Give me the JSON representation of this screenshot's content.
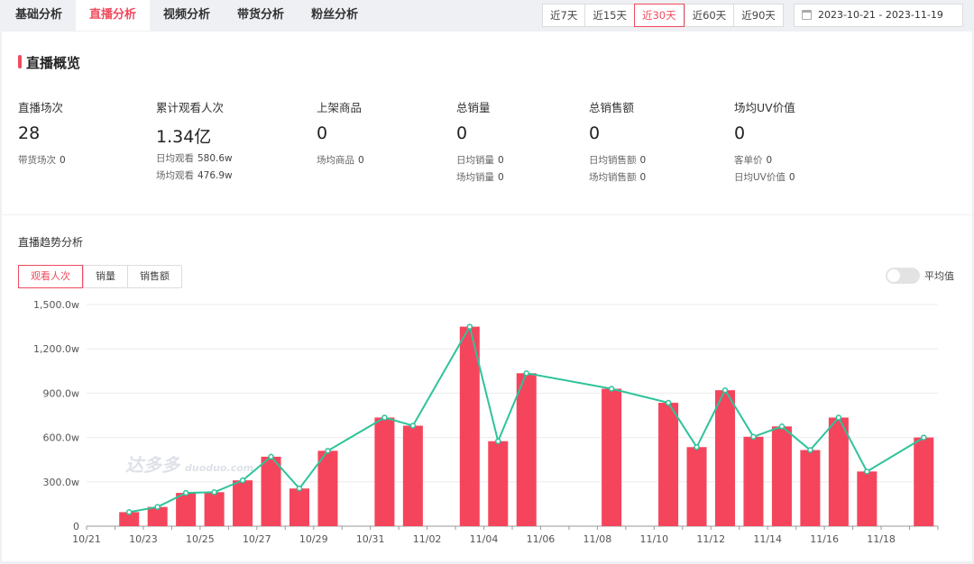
{
  "tabs": [
    "基础分析",
    "直播分析",
    "视频分析",
    "带货分析",
    "粉丝分析"
  ],
  "active_tab": 1,
  "ranges": [
    "近7天",
    "近15天",
    "近30天",
    "近60天",
    "近90天"
  ],
  "active_range": 2,
  "date_range": "2023-10-21 - 2023-11-19",
  "overview_title": "直播概览",
  "metrics": [
    {
      "label": "直播场次",
      "value": "28",
      "subs": [
        {
          "k": "带货场次",
          "v": "0"
        }
      ]
    },
    {
      "label": "累计观看人次",
      "value": "1.34亿",
      "subs": [
        {
          "k": "日均观看",
          "v": "580.6w"
        },
        {
          "k": "场均观看",
          "v": "476.9w"
        }
      ]
    },
    {
      "label": "上架商品",
      "value": "0",
      "subs": [
        {
          "k": "场均商品",
          "v": "0"
        }
      ]
    },
    {
      "label": "总销量",
      "value": "0",
      "subs": [
        {
          "k": "日均销量",
          "v": "0"
        },
        {
          "k": "场均销量",
          "v": "0"
        }
      ]
    },
    {
      "label": "总销售额",
      "value": "0",
      "subs": [
        {
          "k": "日均销售额",
          "v": "0"
        },
        {
          "k": "场均销售额",
          "v": "0"
        }
      ]
    },
    {
      "label": "场均UV价值",
      "value": "0",
      "subs": [
        {
          "k": "客单价",
          "v": "0"
        },
        {
          "k": "日均UV价值",
          "v": "0"
        }
      ]
    }
  ],
  "trend_title": "直播趋势分析",
  "metric_tabs": [
    "观看人次",
    "销量",
    "销售额"
  ],
  "active_metric_tab": 0,
  "toggle_label": "平均值",
  "watermark": "达多多",
  "colors": {
    "accent": "#f04b5d",
    "bar": "#f5455c",
    "line": "#2ec39a"
  },
  "chart_data": {
    "type": "bar",
    "x_ticks": [
      "10/21",
      "10/23",
      "10/25",
      "10/27",
      "10/29",
      "10/31",
      "11/02",
      "11/04",
      "11/06",
      "11/08",
      "11/10",
      "11/12",
      "11/14",
      "11/16",
      "11/18"
    ],
    "y_ticks": [
      "0",
      "300.0w",
      "600.0w",
      "900.0w",
      "1,200.0w",
      "1,500.0w"
    ],
    "ylim": [
      0,
      1500
    ],
    "unit": "w",
    "days": [
      "10/21",
      "10/22",
      "10/23",
      "10/24",
      "10/25",
      "10/26",
      "10/27",
      "10/28",
      "10/29",
      "10/30",
      "10/31",
      "11/01",
      "11/02",
      "11/03",
      "11/04",
      "11/05",
      "11/06",
      "11/07",
      "11/08",
      "11/09",
      "11/10",
      "11/11",
      "11/12",
      "11/13",
      "11/14",
      "11/15",
      "11/16",
      "11/17",
      "11/18",
      "11/19"
    ],
    "series": [
      {
        "type": "bar",
        "values": [
          null,
          95,
          130,
          225,
          230,
          310,
          470,
          255,
          510,
          null,
          735,
          680,
          null,
          1350,
          575,
          1035,
          null,
          null,
          930,
          null,
          835,
          535,
          920,
          605,
          675,
          515,
          735,
          370,
          null,
          600
        ]
      },
      {
        "type": "line",
        "values": [
          null,
          95,
          130,
          225,
          230,
          310,
          470,
          255,
          510,
          null,
          735,
          680,
          null,
          1350,
          575,
          1035,
          null,
          null,
          930,
          null,
          835,
          535,
          920,
          605,
          675,
          515,
          735,
          370,
          null,
          600
        ]
      }
    ]
  }
}
